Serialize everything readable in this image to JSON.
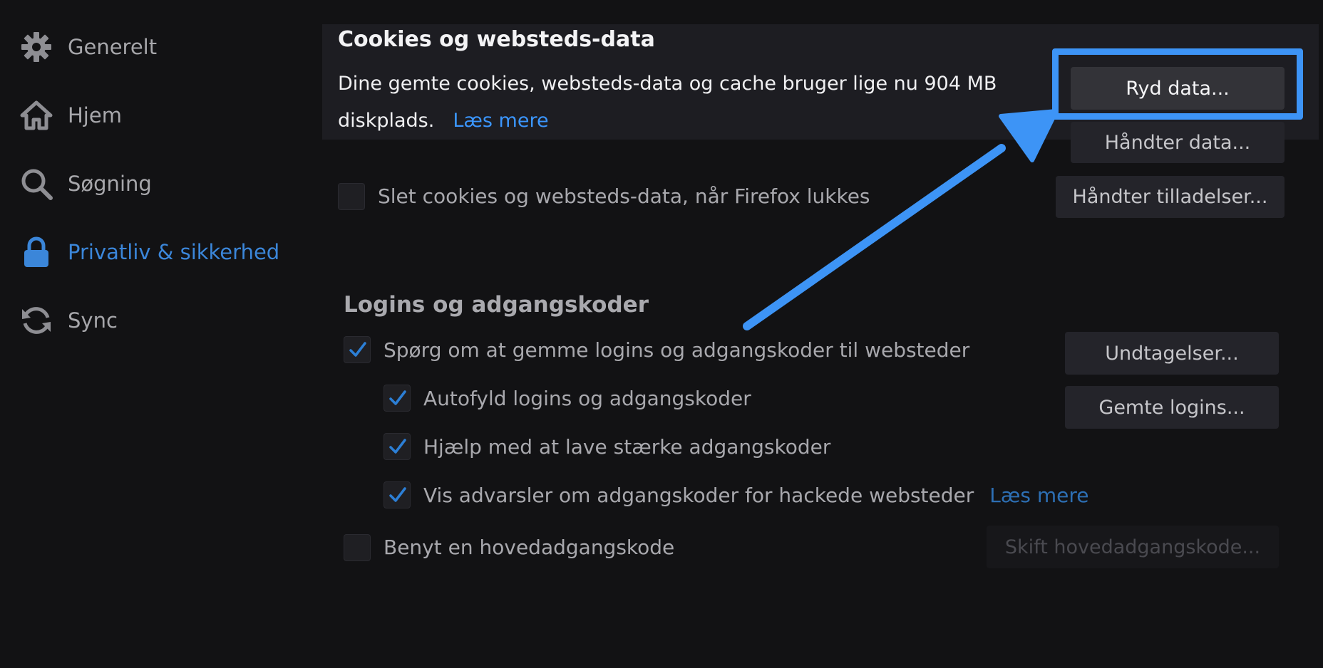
{
  "sidebar": {
    "items": [
      {
        "label": "Generelt",
        "icon": "gear-icon"
      },
      {
        "label": "Hjem",
        "icon": "home-icon"
      },
      {
        "label": "Søgning",
        "icon": "search-icon"
      },
      {
        "label": "Privatliv & sikkerhed",
        "icon": "lock-icon",
        "active": true
      },
      {
        "label": "Sync",
        "icon": "sync-icon"
      }
    ]
  },
  "cookies": {
    "title": "Cookies og websteds-data",
    "description": "Dine gemte cookies, websteds-data og cache bruger lige nu 904 MB diskplads.",
    "learn_more": "Læs mere",
    "clear_button": "Ryd data...",
    "manage_button": "Håndter data...",
    "permissions_button": "Håndter tilladelser...",
    "delete_on_close_label": "Slet cookies og websteds-data, når Firefox lukkes",
    "delete_on_close_checked": false
  },
  "logins": {
    "title": "Logins og adgangskoder",
    "ask_save_label": "Spørg om at gemme logins og adgangskoder til websteder",
    "ask_save_checked": true,
    "autofill_label": "Autofyld logins og adgangskoder",
    "autofill_checked": true,
    "strong_label": "Hjælp med at lave stærke adgangskoder",
    "strong_checked": true,
    "breach_label": "Vis advarsler om adgangskoder for hackede websteder",
    "breach_checked": true,
    "breach_learn_more": "Læs mere",
    "master_label": "Benyt en hovedadgangskode",
    "master_checked": false,
    "exceptions_button": "Undtagelser...",
    "saved_logins_button": "Gemte logins...",
    "change_master_button": "Skift hovedadgangskode..."
  },
  "colors": {
    "accent": "#3b86d9",
    "annotation": "#3d94f6",
    "background": "#121214"
  }
}
